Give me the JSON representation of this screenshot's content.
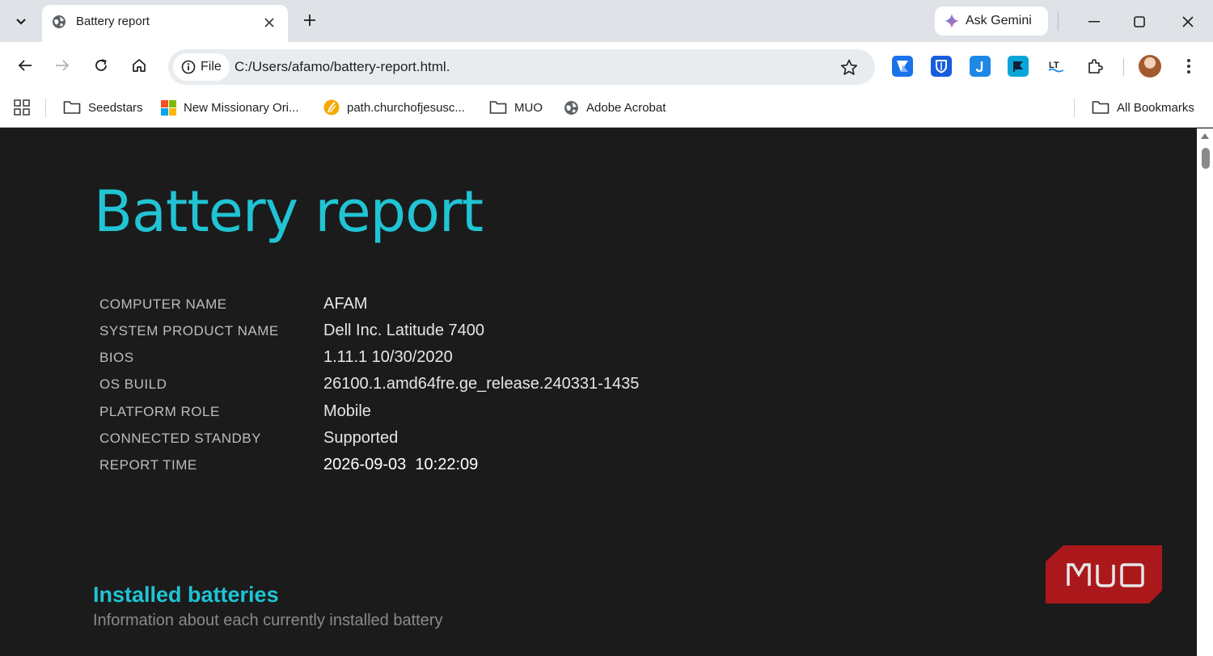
{
  "browser": {
    "tab": {
      "title": "Battery report"
    },
    "gemini_label": "Ask Gemini",
    "omnibox": {
      "chip_label": "File",
      "url": "C:/Users/afamo/battery-report.html."
    },
    "bookmarks": [
      {
        "label": "Seedstars",
        "icon": "folder-icon"
      },
      {
        "label": "New Missionary Ori...",
        "icon": "microsoft-icon"
      },
      {
        "label": "path.churchofjesusc...",
        "icon": "path-icon"
      },
      {
        "label": "MUO",
        "icon": "folder-icon"
      },
      {
        "label": "Adobe Acrobat",
        "icon": "globe-icon"
      }
    ],
    "all_bookmarks_label": "All Bookmarks",
    "extensions": [
      {
        "name": "ext-1",
        "color": "#1a73e8"
      },
      {
        "name": "bitwarden-extension",
        "color": "#175ddc"
      },
      {
        "name": "ext-3",
        "color": "#1e88e5"
      },
      {
        "name": "ext-4",
        "color": "#0aa5d8"
      },
      {
        "name": "languagetool-extension",
        "color": "#222222"
      }
    ]
  },
  "report": {
    "title": "Battery report",
    "rows": [
      {
        "key": "COMPUTER NAME",
        "value": "AFAM"
      },
      {
        "key": "SYSTEM PRODUCT NAME",
        "value": "Dell Inc. Latitude 7400"
      },
      {
        "key": "BIOS",
        "value": "1.11.1 10/30/2020"
      },
      {
        "key": "OS BUILD",
        "value": "26100.1.amd64fre.ge_release.240331-1435"
      },
      {
        "key": "PLATFORM ROLE",
        "value": "Mobile"
      },
      {
        "key": "CONNECTED STANDBY",
        "value": "Supported"
      },
      {
        "key": "REPORT TIME",
        "value": "2026-09-03  10:22:09"
      }
    ],
    "installed_batteries": {
      "title": "Installed batteries",
      "subtitle": "Information about each currently installed battery"
    },
    "watermark": "MUO"
  },
  "colors": {
    "accent": "#20c4d4",
    "page_background": "#1b1b1b",
    "watermark_red": "#c4181b"
  }
}
